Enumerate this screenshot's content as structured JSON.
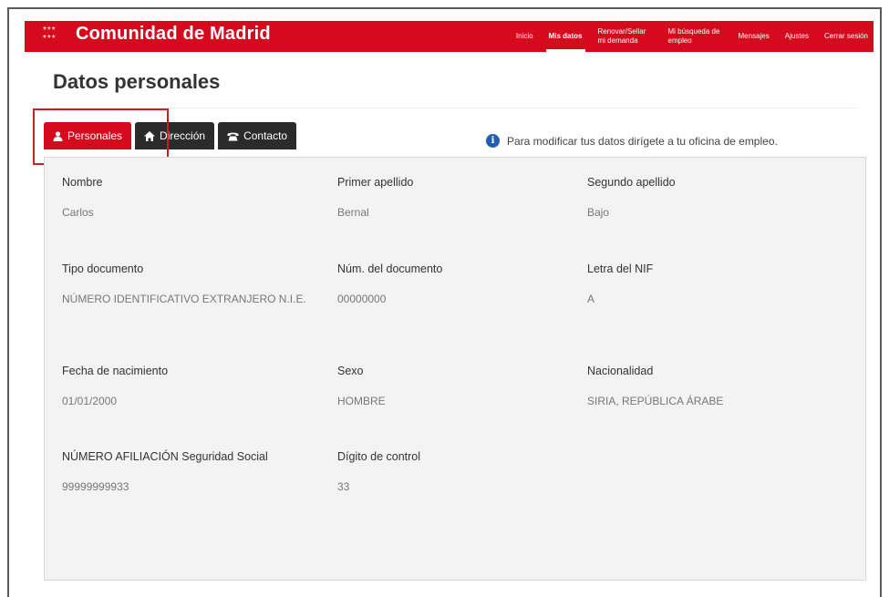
{
  "header": {
    "stars": "*** ***",
    "brand": "Comunidad de Madrid",
    "nav": [
      {
        "label": "Inicio",
        "active": false
      },
      {
        "label": "Mis datos",
        "active": true
      },
      {
        "label": "Renovar/Sellar mi demanda",
        "active": false
      },
      {
        "label": "Mi búsqueda de empleo",
        "active": false
      },
      {
        "label": "Mensajes",
        "active": false
      },
      {
        "label": "Ajustes",
        "active": false
      },
      {
        "label": "Cerrar sesión",
        "active": false
      }
    ]
  },
  "page": {
    "title": "Datos personales",
    "info": "Para modificar tus datos dirígete a tu oficina de empleo."
  },
  "tabs": [
    {
      "label": "Personales",
      "icon": "person-icon",
      "active": true
    },
    {
      "label": "Dirección",
      "icon": "home-icon",
      "active": false
    },
    {
      "label": "Contacto",
      "icon": "phone-icon",
      "active": false
    }
  ],
  "fields": {
    "nombre": {
      "label": "Nombre",
      "value": "Carlos"
    },
    "primer_apellido": {
      "label": "Primer apellido",
      "value": "Bernal"
    },
    "segundo_apellido": {
      "label": "Segundo apellido",
      "value": "Bajo"
    },
    "tipo_documento": {
      "label": "Tipo documento",
      "value": "NÚMERO IDENTIFICATIVO EXTRANJERO N.I.E."
    },
    "num_documento": {
      "label": "Núm. del documento",
      "value": "00000000"
    },
    "letra_nif": {
      "label": "Letra del NIF",
      "value": "A"
    },
    "fecha_nacimiento": {
      "label": "Fecha de nacimiento",
      "value": "01/01/2000"
    },
    "sexo": {
      "label": "Sexo",
      "value": "HOMBRE"
    },
    "nacionalidad": {
      "label": "Nacionalidad",
      "value": "SIRIA, REPÚBLICA ÁRABE"
    },
    "afiliacion": {
      "label": "NÚMERO AFILIACIÓN Seguridad Social",
      "value": "99999999933"
    },
    "digito_control": {
      "label": "Dígito de control",
      "value": "33"
    }
  },
  "colors": {
    "brand_red": "#d50a1d",
    "tab_dark": "#2b2b2b",
    "info_blue": "#1f5fb4"
  }
}
